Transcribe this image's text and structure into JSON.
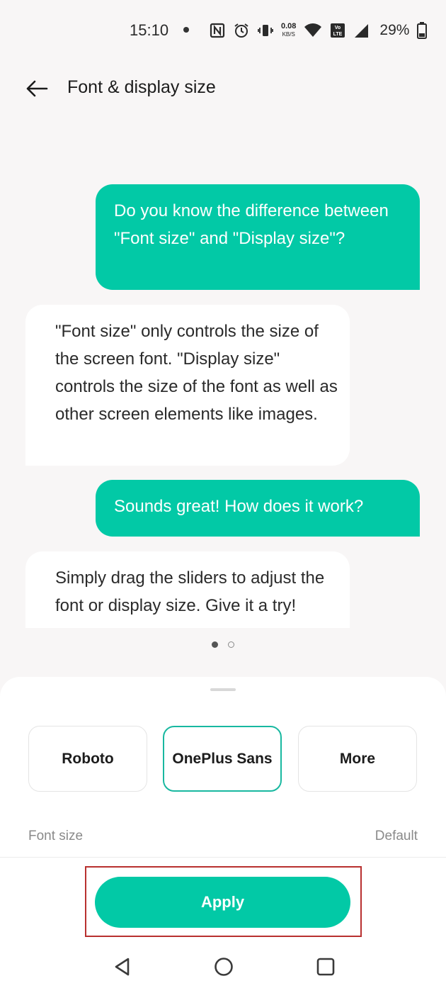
{
  "status_bar": {
    "time": "15:10",
    "net_speed_value": "0.08",
    "net_speed_unit": "KB/S",
    "volte_label": "Vo LTE",
    "battery_percent": "29%"
  },
  "header": {
    "title": "Font & display size"
  },
  "chat": [
    {
      "side": "out",
      "text": "Do you know the difference between \"Font size\" and \"Display size\"?"
    },
    {
      "side": "in",
      "text": "\"Font size\" only controls the size of the screen font. \"Display size\" controls the size of the font as well as other screen elements like images."
    },
    {
      "side": "out",
      "text": "Sounds great! How does it work?"
    },
    {
      "side": "in",
      "text": "Simply drag the sliders to adjust the font or display size. Give it a try!"
    }
  ],
  "pager": {
    "active_page": 1,
    "total_pages": 2
  },
  "font_options": {
    "roboto": "Roboto",
    "oneplus_sans": "OnePlus Sans",
    "more": "More",
    "selected": "OnePlus Sans"
  },
  "font_size": {
    "label": "Font size",
    "value": "Default"
  },
  "apply_label": "Apply",
  "colors": {
    "accent": "#02c9a6",
    "highlight_frame": "#b8302f",
    "background": "#f8f6f6"
  },
  "nav_icons": [
    "back-triangle-icon",
    "home-circle-icon",
    "recents-square-icon"
  ]
}
